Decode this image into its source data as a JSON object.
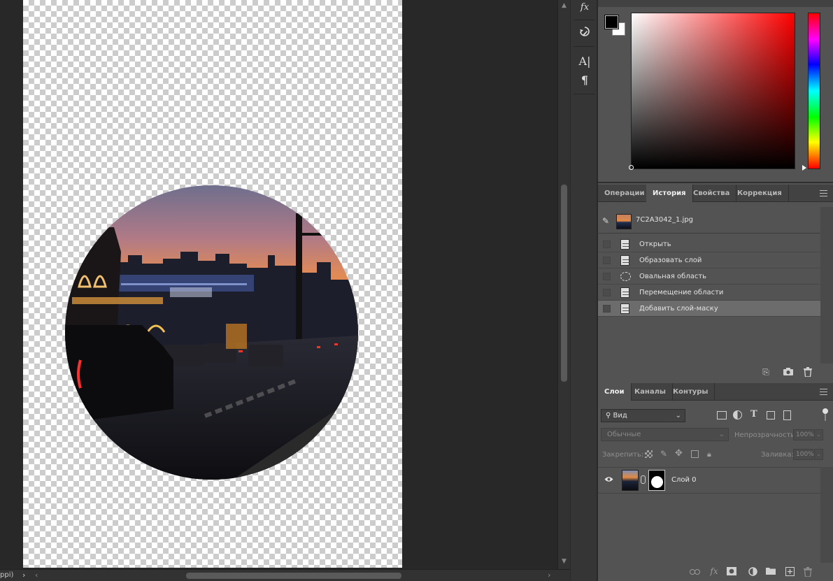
{
  "status_bar": {
    "zoom_fragment": "ppi)"
  },
  "history_tabs": [
    "Операции",
    "История",
    "Свойства",
    "Коррекция"
  ],
  "history": {
    "snapshot_name": "7C2A3042_1.jpg",
    "steps": [
      {
        "label": "Открыть",
        "icon": "document-icon"
      },
      {
        "label": "Образовать слой",
        "icon": "document-icon"
      },
      {
        "label": "Овальная область",
        "icon": "elliptical-marquee-icon"
      },
      {
        "label": "Перемещение области",
        "icon": "document-icon"
      },
      {
        "label": "Добавить слой-маску",
        "icon": "document-icon",
        "selected": true
      }
    ]
  },
  "layers_tabs": [
    "Слои",
    "Каналы",
    "Контуры"
  ],
  "layers": {
    "kind_filter": "Вид",
    "blend_mode": "Обычные",
    "opacity_label": "Непрозрачность:",
    "opacity_value": "100%",
    "lock_label": "Закрепить:",
    "fill_label": "Заливка:",
    "fill_value": "100%",
    "items": [
      {
        "name": "Слой 0",
        "visible": true,
        "has_mask": true
      }
    ]
  },
  "tool_strip": {
    "fx_label": "fx"
  },
  "colors": {
    "foreground": "#000000",
    "background": "#ffffff",
    "panel": "#535353",
    "selected_row": "#6c6c6c"
  }
}
